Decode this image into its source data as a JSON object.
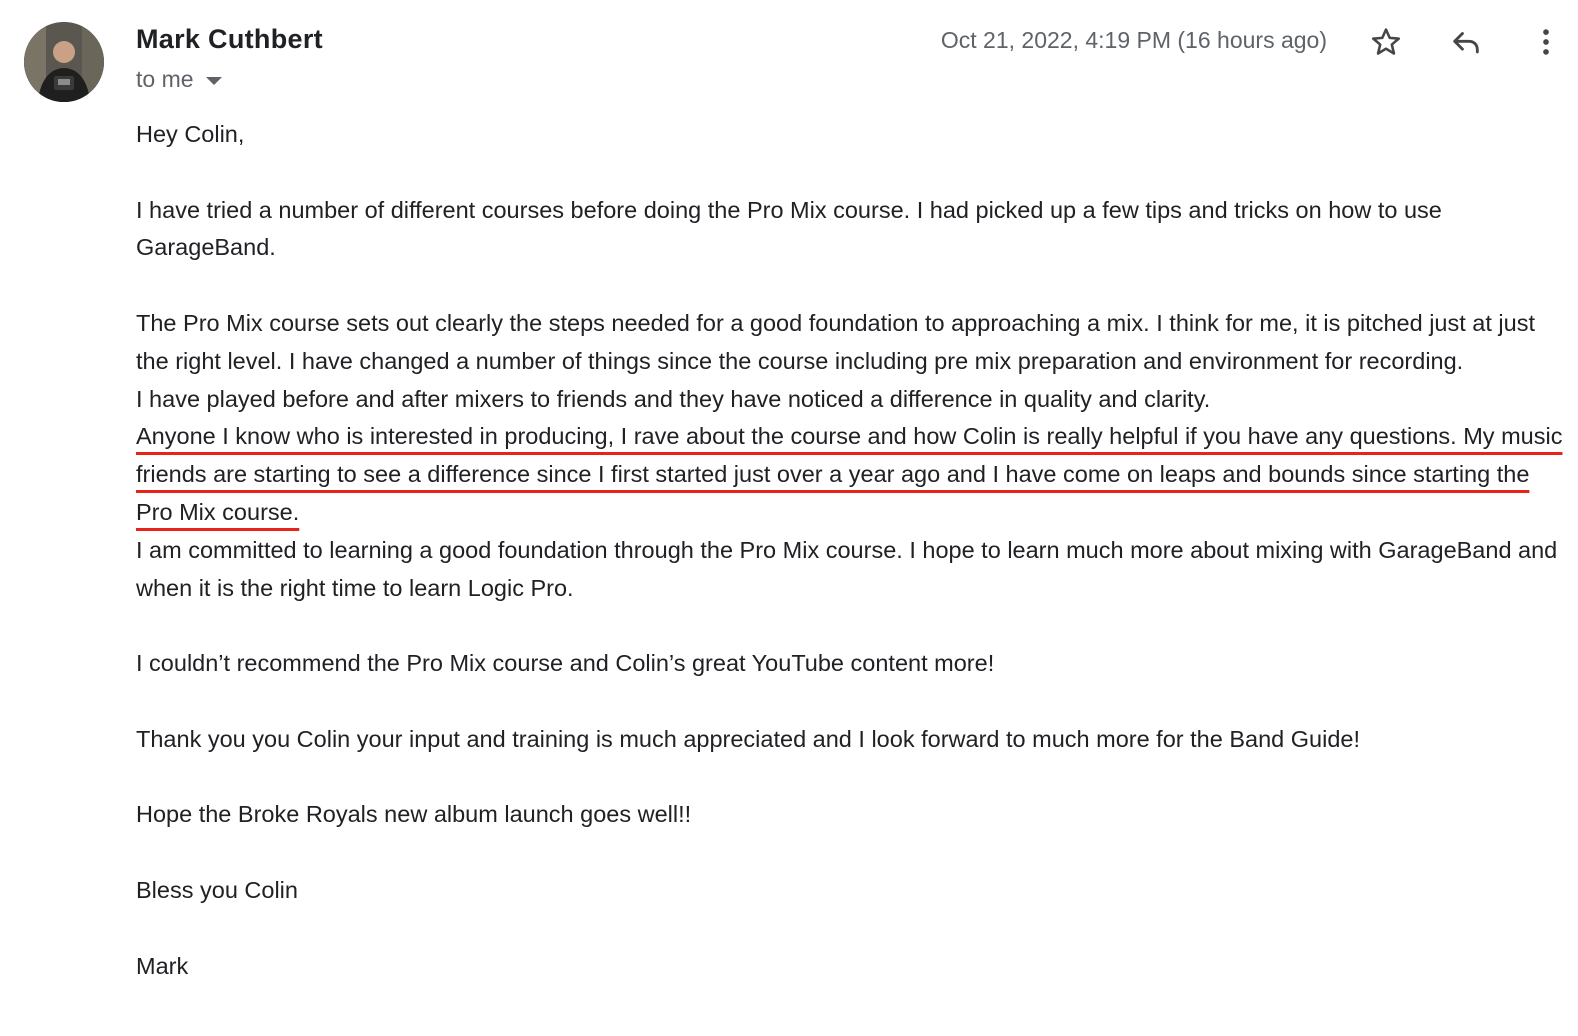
{
  "message": {
    "sender_name": "Mark Cuthbert",
    "recipient_label": "to me",
    "timestamp": "Oct 21, 2022, 4:19 PM (16 hours ago)"
  },
  "icons": {
    "avatar": "sender-avatar-photo",
    "star": "star-icon",
    "reply": "reply-icon",
    "more": "more-vert-icon",
    "recipient_toggle": "caret-down-icon"
  },
  "colors": {
    "highlight_underline": "#e8231a",
    "secondary_text": "#5f6368",
    "primary_text": "#202124"
  },
  "body": {
    "greeting": "Hey Colin,",
    "p1": "I have tried a number of different courses before doing the Pro Mix course. I had picked up a few tips and tricks on how to use GarageBand.",
    "p2": "The Pro Mix course sets out clearly the steps needed for a good foundation to approaching a mix. I think for me, it is pitched just at just the right level. I have changed a number of things since the course including pre mix preparation and environment for recording.",
    "p3": "I have played before and after mixers to friends and they have noticed a difference in quality and clarity.",
    "p4_highlighted": "Anyone I know who is interested in producing, I rave about the course and how Colin is really helpful if you have any questions. My music friends are starting to see a difference since I first started just over a year ago and I have come on leaps and bounds since starting the Pro Mix course.",
    "p5": "I am committed to learning a good foundation through the Pro Mix course. I hope to learn much more about mixing with GarageBand and when it is the right time to learn Logic Pro.",
    "p6": "I couldn’t recommend the Pro Mix course and Colin’s great YouTube content more!",
    "p7": "Thank you you Colin your input and training is much appreciated and I look forward to much more for the Band Guide!",
    "p8": "Hope the Broke Royals new album launch goes well!!",
    "p9": "Bless you Colin",
    "signature": "Mark"
  }
}
